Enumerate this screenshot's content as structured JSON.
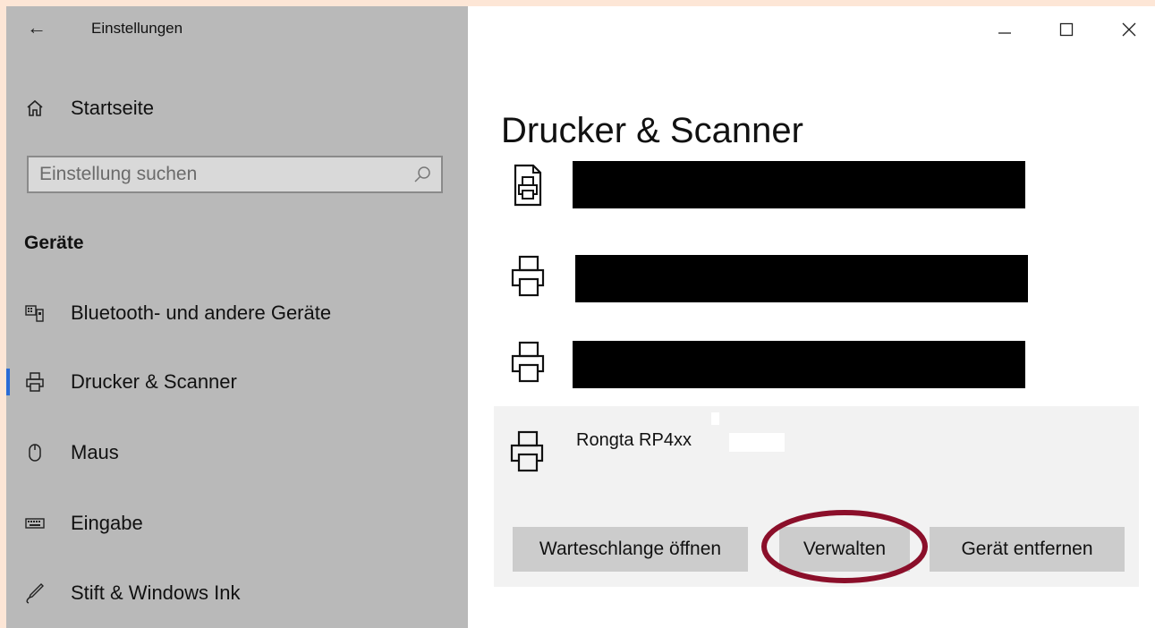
{
  "window": {
    "title": "Einstellungen",
    "back_icon": "back-arrow-icon",
    "controls": [
      "minimize-icon",
      "maximize-icon",
      "close-icon"
    ]
  },
  "sidebar": {
    "home_label": "Startseite",
    "search_placeholder": "Einstellung suchen",
    "section_title": "Geräte",
    "items": [
      {
        "label": "Bluetooth- und andere Geräte",
        "icon": "bluetooth-device-icon"
      },
      {
        "label": "Drucker & Scanner",
        "icon": "printer-icon",
        "active": true
      },
      {
        "label": "Maus",
        "icon": "mouse-icon"
      },
      {
        "label": "Eingabe",
        "icon": "keyboard-icon"
      },
      {
        "label": "Stift & Windows Ink",
        "icon": "pen-icon"
      }
    ]
  },
  "main": {
    "page_title": "Drucker & Scanner",
    "printers": [
      {
        "name": "",
        "icon": "fax-printer-icon",
        "redacted": true
      },
      {
        "name": "",
        "icon": "printer-icon",
        "redacted": true
      },
      {
        "name": "",
        "icon": "printer-icon",
        "redacted": true
      },
      {
        "name": "Rongta RP4xx",
        "icon": "printer-icon",
        "selected": true
      }
    ],
    "actions": {
      "queue": "Warteschlange öffnen",
      "manage": "Verwalten",
      "remove": "Gerät entfernen"
    }
  },
  "colors": {
    "outer_background": "#fde6d6",
    "sidebar_background": "#b9b9b9",
    "selected_card": "#f2f2f2",
    "button": "#cccccc",
    "annotation_ellipse": "#8b0f2a",
    "active_indicator": "#2b6cd6"
  }
}
